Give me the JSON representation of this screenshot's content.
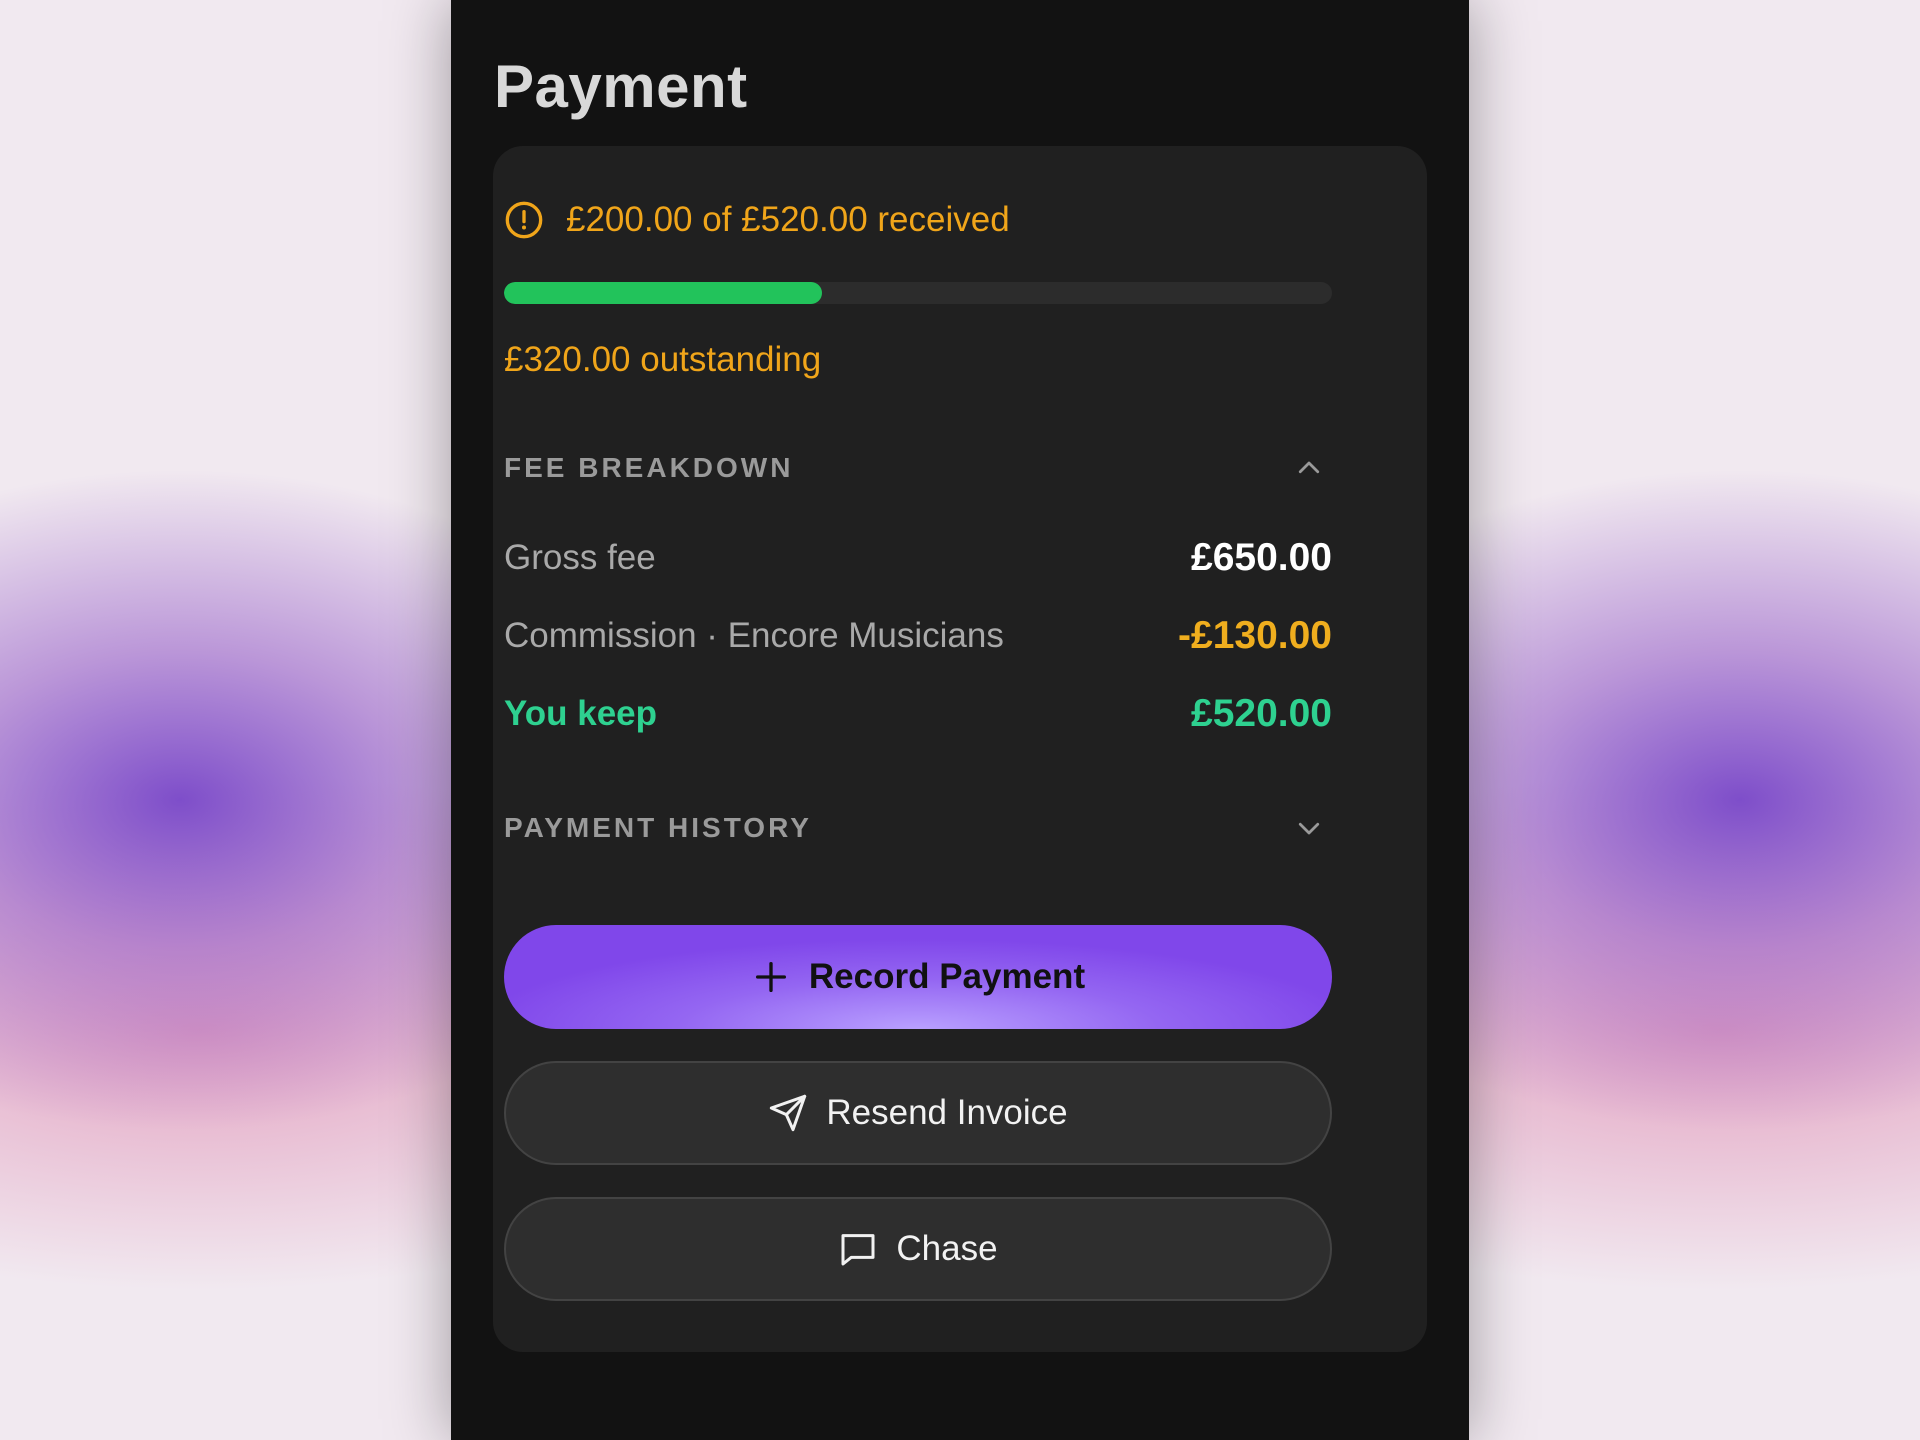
{
  "page": {
    "title": "Payment"
  },
  "status": {
    "received_text": "£200.00 of £520.00 received",
    "progress_fraction": 0.3846,
    "outstanding_text": "£320.00 outstanding",
    "icon": "alert-circle-icon",
    "warning_color": "#f0a51a",
    "progress_color": "#22c35b"
  },
  "fee_breakdown": {
    "title": "FEE BREAKDOWN",
    "expanded": true,
    "rows": [
      {
        "label": "Gross fee",
        "value": "£650.00"
      },
      {
        "label": "Commission · Encore Musicians",
        "value": "-£130.00"
      },
      {
        "label": "You keep",
        "value": "£520.00"
      }
    ]
  },
  "payment_history": {
    "title": "PAYMENT HISTORY",
    "expanded": false
  },
  "actions": {
    "record_payment": "Record Payment",
    "resend_invoice": "Resend Invoice",
    "chase": "Chase"
  },
  "colors": {
    "accent": "#8b5cf6",
    "keep": "#2ed190",
    "negative": "#f0ae1e"
  }
}
